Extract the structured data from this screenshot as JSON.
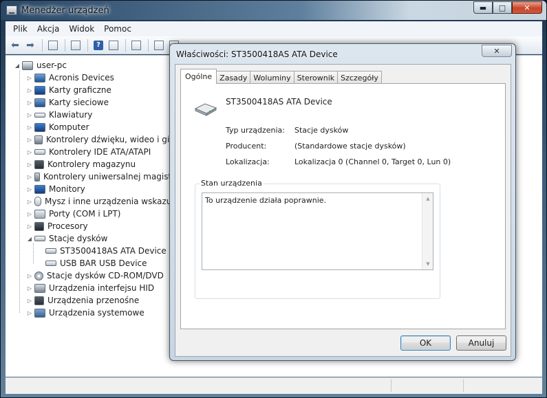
{
  "window": {
    "title": "Menedżer urządzeń",
    "buttons": {
      "minimize": "▬",
      "maximize": "□",
      "close": "✕"
    }
  },
  "menu": [
    "Plik",
    "Akcja",
    "Widok",
    "Pomoc"
  ],
  "tree": {
    "root": "user-pc",
    "items": [
      {
        "label": "Acronis Devices",
        "icon": "acronis-icon"
      },
      {
        "label": "Karty graficzne",
        "icon": "display-adapter-icon"
      },
      {
        "label": "Karty sieciowe",
        "icon": "network-adapter-icon"
      },
      {
        "label": "Klawiatury",
        "icon": "keyboard-icon"
      },
      {
        "label": "Komputer",
        "icon": "computer-icon"
      },
      {
        "label": "Kontrolery dźwięku, wideo i gier",
        "icon": "sound-icon"
      },
      {
        "label": "Kontrolery IDE ATA/ATAPI",
        "icon": "ide-controller-icon"
      },
      {
        "label": "Kontrolery magazynu",
        "icon": "storage-controller-icon"
      },
      {
        "label": "Kontrolery uniwersalnej magistrali szeregowej",
        "icon": "usb-icon"
      },
      {
        "label": "Monitory",
        "icon": "monitor-icon"
      },
      {
        "label": "Mysz i inne urządzenia wskazujące",
        "icon": "mouse-icon"
      },
      {
        "label": "Porty (COM i LPT)",
        "icon": "port-icon"
      },
      {
        "label": "Procesory",
        "icon": "processor-icon"
      },
      {
        "label": "Stacje dysków",
        "icon": "disk-drive-icon",
        "expanded": true,
        "children": [
          "ST3500418AS ATA Device",
          "USB BAR USB Device"
        ]
      },
      {
        "label": "Stacje dysków CD-ROM/DVD",
        "icon": "cdrom-icon"
      },
      {
        "label": "Urządzenia interfejsu HID",
        "icon": "hid-icon"
      },
      {
        "label": "Urządzenia przenośne",
        "icon": "portable-device-icon"
      },
      {
        "label": "Urządzenia systemowe",
        "icon": "system-device-icon"
      }
    ]
  },
  "dialog": {
    "title": "Właściwości: ST3500418AS ATA Device",
    "close": "✕",
    "tabs": [
      "Ogólne",
      "Zasady",
      "Woluminy",
      "Sterownik",
      "Szczegóły"
    ],
    "active_tab": "Ogólne",
    "device_name": "ST3500418AS ATA Device",
    "props": [
      {
        "label": "Typ urządzenia:",
        "value": "Stacje dysków"
      },
      {
        "label": "Producent:",
        "value": "(Standardowe stacje dysków)"
      },
      {
        "label": "Lokalizacja:",
        "value": "Lokalizacja 0 (Channel 0, Target 0, Lun 0)"
      }
    ],
    "status_group_label": "Stan urządzenia",
    "status_text": "To urządzenie działa poprawnie.",
    "ok_label": "OK",
    "cancel_label": "Anuluj"
  }
}
